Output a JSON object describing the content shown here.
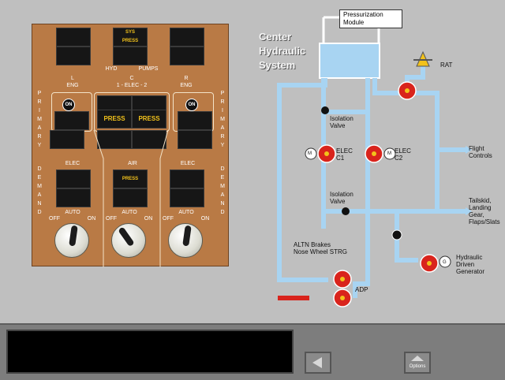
{
  "overhead_panel": {
    "sys_press_label": "SYS\nPRESS",
    "hyd_label": "HYD",
    "pumps_label": "PUMPS",
    "left_eng_label": "L\nENG",
    "center_label": "C\n1 - ELEC - 2",
    "right_eng_label": "R\nENG",
    "on_label": "ON",
    "press_label": "PRESS",
    "elec_label": "ELEC",
    "air_label": "AIR",
    "primary_label": "PRIMARY",
    "demand_label": "DEMAND",
    "off_label": "OFF",
    "auto_label": "AUTO",
    "on_switch_label": "ON"
  },
  "schematic": {
    "title": "Center\nHydraulic\nSystem",
    "pressurization_module": "Pressurization\nModule",
    "rat": "RAT",
    "isolation_valve_1": "Isolation\nValve",
    "isolation_valve_2": "Isolation\nValve",
    "elec_c1": "ELEC\nC1",
    "elec_c2": "ELEC\nC2",
    "motor_label": "M",
    "flight_controls": "Flight\nControls",
    "tailskid": "Tailskid,\nLanding\nGear,\nFlaps/Slats",
    "altn_brakes": "ALTN Brakes\nNose Wheel STRG",
    "hdg": "Hydraulic\nDriven\nGenerator",
    "generator_label": "G",
    "adp": "ADP"
  },
  "bottom_bar": {
    "options_label": "Options"
  },
  "colors": {
    "panel": "#b97a45",
    "fluid": "#a8d4f2",
    "line": "#ffffff",
    "pump": "#d9241c",
    "amber": "#f2c21b"
  }
}
